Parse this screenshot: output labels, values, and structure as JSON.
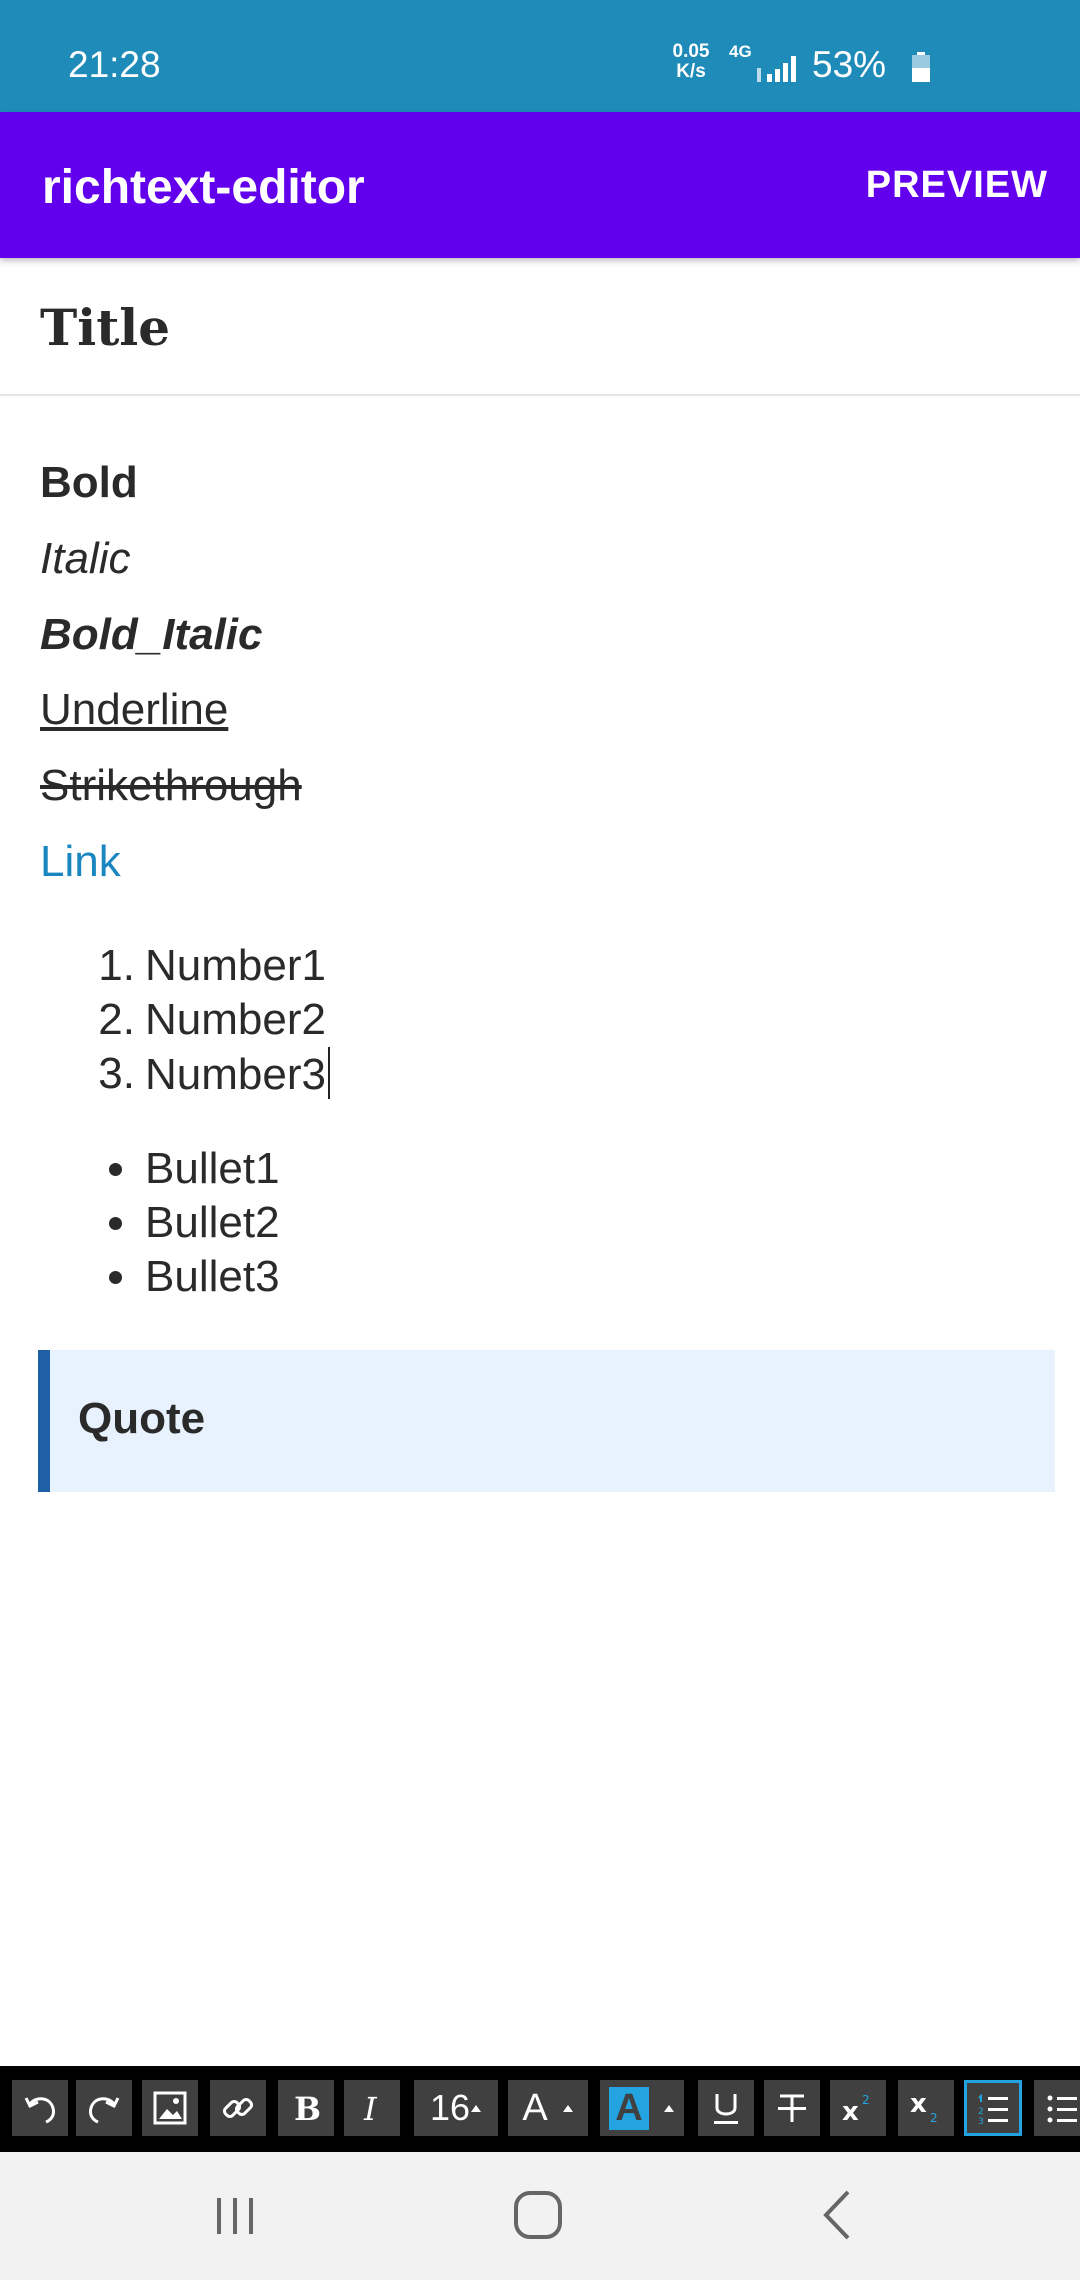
{
  "status_bar": {
    "time": "21:28",
    "net_speed_value": "0.05",
    "net_speed_unit": "K/s",
    "network_type": "4G",
    "battery_percent": "53%"
  },
  "app_bar": {
    "title": "richtext-editor",
    "action_label": "PREVIEW"
  },
  "title_field": {
    "text": "Title"
  },
  "editor": {
    "bold": "Bold",
    "italic": "Italic",
    "bold_italic": "Bold_Italic",
    "underline": "Underline",
    "strikethrough": "Strikethrough",
    "link": "Link",
    "numbered_list": [
      {
        "marker": "1.",
        "text": "Number1"
      },
      {
        "marker": "2.",
        "text": "Number2"
      },
      {
        "marker": "3.",
        "text": "Number3"
      }
    ],
    "bullet_list": [
      "Bullet1",
      "Bullet2",
      "Bullet3"
    ],
    "quote": "Quote"
  },
  "toolbar": {
    "font_size": "16",
    "font_color_letter": "A",
    "background_color_letter": "A",
    "icons": [
      "undo-icon",
      "redo-icon",
      "image-icon",
      "link-icon",
      "bold-icon",
      "italic-icon",
      "font-size",
      "font-color-icon",
      "background-color-icon",
      "underline-icon",
      "strikethrough-icon",
      "superscript-icon",
      "subscript-icon",
      "numbered-list-icon",
      "bullet-list-icon"
    ],
    "active_item": "numbered-list"
  },
  "colors": {
    "status_bar": "#1e8bb8",
    "app_bar": "#6200ee",
    "link": "#1a86c0",
    "quote_bg": "#e8f2fe",
    "quote_border": "#1e5fa6",
    "toolbar_active_border": "#23a4e0"
  }
}
